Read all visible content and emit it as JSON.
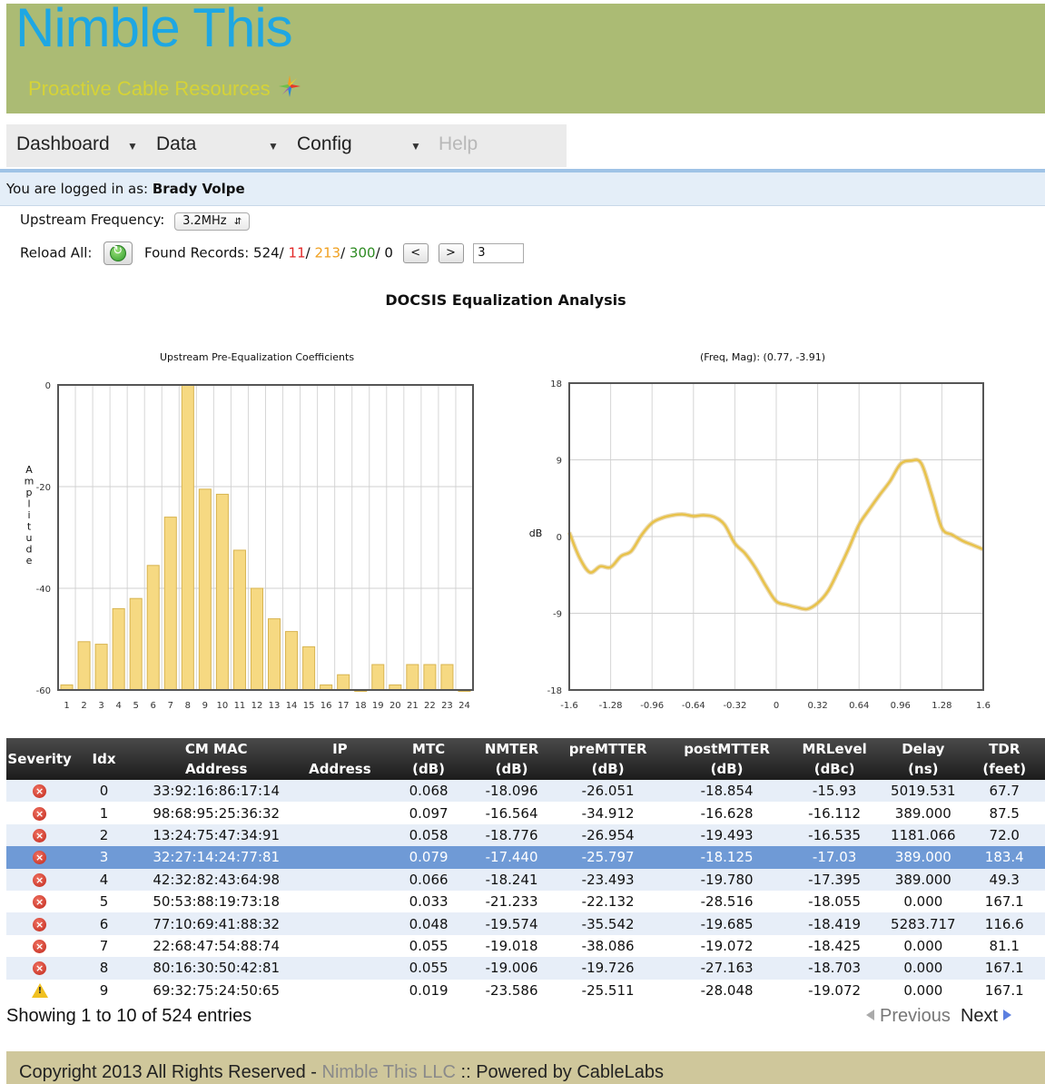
{
  "header": {
    "logo": "Nimble This",
    "tagline": "Proactive Cable Resources"
  },
  "menu": [
    {
      "label": "Dashboard",
      "enabled": true
    },
    {
      "label": "Data",
      "enabled": true
    },
    {
      "label": "Config",
      "enabled": true
    },
    {
      "label": "Help",
      "enabled": false
    }
  ],
  "login": {
    "prefix": "You are logged in as: ",
    "user": "Brady Volpe"
  },
  "controls": {
    "freq_label": "Upstream Frequency:",
    "freq_value": "3.2MHz",
    "reload_label": "Reload All:",
    "found_label": "Found Records: 524/",
    "found_red": "11",
    "found_orange": "213",
    "found_green": "300",
    "found_tail": "0",
    "prev_btn": "<",
    "next_btn": ">",
    "page_value": "3"
  },
  "main_title": "DOCSIS Equalization Analysis",
  "chart_data": [
    {
      "type": "bar",
      "title": "Upstream Pre-Equalization Coefficients",
      "ylabel": "Amplitude",
      "xlabel": "",
      "categories": [
        "1",
        "2",
        "3",
        "4",
        "5",
        "6",
        "7",
        "8",
        "9",
        "10",
        "11",
        "12",
        "13",
        "14",
        "15",
        "16",
        "17",
        "18",
        "19",
        "20",
        "21",
        "22",
        "23",
        "24"
      ],
      "values": [
        -59,
        -50.5,
        -51,
        -44,
        -42,
        -35.5,
        -26,
        0,
        -20.5,
        -21.5,
        -32.5,
        -40,
        -46,
        -48.5,
        -51.5,
        -59,
        -57,
        -60,
        -55,
        -59,
        -55,
        -55,
        -55,
        -60
      ],
      "ylim": [
        -60,
        0
      ],
      "yticks": [
        0,
        -20,
        -40,
        -60
      ],
      "color": "#f6d982",
      "grid": true
    },
    {
      "type": "line",
      "title": "(Freq, Mag): (0.77, -3.91)",
      "ylabel": "dB",
      "xlabel": "",
      "x": [
        -1.6,
        -1.52,
        -1.44,
        -1.36,
        -1.28,
        -1.2,
        -1.12,
        -1.04,
        -0.96,
        -0.88,
        -0.8,
        -0.72,
        -0.64,
        -0.56,
        -0.48,
        -0.4,
        -0.32,
        -0.24,
        -0.16,
        -0.08,
        0,
        0.08,
        0.16,
        0.24,
        0.32,
        0.4,
        0.48,
        0.56,
        0.64,
        0.72,
        0.8,
        0.88,
        0.96,
        1.04,
        1.12,
        1.2,
        1.28,
        1.36,
        1.44,
        1.52,
        1.6
      ],
      "y": [
        0.5,
        -2.5,
        -4.2,
        -3.5,
        -3.6,
        -2.3,
        -1.7,
        0.2,
        1.6,
        2.2,
        2.5,
        2.6,
        2.4,
        2.5,
        2.3,
        1.4,
        -0.8,
        -2.0,
        -3.7,
        -5.8,
        -7.6,
        -8.0,
        -8.3,
        -8.5,
        -7.8,
        -6.4,
        -4.0,
        -1.4,
        1.4,
        3.2,
        4.9,
        6.5,
        8.5,
        8.9,
        8.6,
        5.0,
        1.0,
        0.2,
        -0.5,
        -1.0,
        -1.5
      ],
      "ylim": [
        -18,
        18
      ],
      "xlim": [
        -1.6,
        1.6
      ],
      "yticks": [
        18,
        9,
        0,
        -9,
        -18
      ],
      "xticks": [
        "-1.6",
        "-1.28",
        "-0.96",
        "-0.64",
        "-0.32",
        "0",
        "0.32",
        "0.64",
        "0.96",
        "1.28",
        "1.6"
      ],
      "color": "#e8c24a",
      "grid": true
    }
  ],
  "table": {
    "headers": [
      [
        "Severity"
      ],
      [
        "Idx"
      ],
      [
        "CM MAC",
        "Address"
      ],
      [
        "IP",
        "Address"
      ],
      [
        "MTC",
        "(dB)"
      ],
      [
        "NMTER",
        "(dB)"
      ],
      [
        "preMTTER",
        "(dB)"
      ],
      [
        "postMTTER",
        "(dB)"
      ],
      [
        "MRLevel",
        "(dBc)"
      ],
      [
        "Delay",
        "(ns)"
      ],
      [
        "TDR",
        "(feet)"
      ]
    ],
    "rows": [
      {
        "severity": "error",
        "idx": "0",
        "mac": "33:92:16:86:17:14",
        "ip": "",
        "mtc": "0.068",
        "nmter": "-18.096",
        "pre": "-26.051",
        "post": "-18.854",
        "mrl": "-15.93",
        "delay": "5019.531",
        "tdr": "67.7"
      },
      {
        "severity": "error",
        "idx": "1",
        "mac": "98:68:95:25:36:32",
        "ip": "",
        "mtc": "0.097",
        "nmter": "-16.564",
        "pre": "-34.912",
        "post": "-16.628",
        "mrl": "-16.112",
        "delay": "389.000",
        "tdr": "87.5"
      },
      {
        "severity": "error",
        "idx": "2",
        "mac": "13:24:75:47:34:91",
        "ip": "",
        "mtc": "0.058",
        "nmter": "-18.776",
        "pre": "-26.954",
        "post": "-19.493",
        "mrl": "-16.535",
        "delay": "1181.066",
        "tdr": "72.0"
      },
      {
        "severity": "error",
        "idx": "3",
        "mac": "32:27:14:24:77:81",
        "ip": "",
        "mtc": "0.079",
        "nmter": "-17.440",
        "pre": "-25.797",
        "post": "-18.125",
        "mrl": "-17.03",
        "delay": "389.000",
        "tdr": "183.4",
        "selected": true
      },
      {
        "severity": "error",
        "idx": "4",
        "mac": "42:32:82:43:64:98",
        "ip": "",
        "mtc": "0.066",
        "nmter": "-18.241",
        "pre": "-23.493",
        "post": "-19.780",
        "mrl": "-17.395",
        "delay": "389.000",
        "tdr": "49.3"
      },
      {
        "severity": "error",
        "idx": "5",
        "mac": "50:53:88:19:73:18",
        "ip": "",
        "mtc": "0.033",
        "nmter": "-21.233",
        "pre": "-22.132",
        "post": "-28.516",
        "mrl": "-18.055",
        "delay": "0.000",
        "tdr": "167.1"
      },
      {
        "severity": "error",
        "idx": "6",
        "mac": "77:10:69:41:88:32",
        "ip": "",
        "mtc": "0.048",
        "nmter": "-19.574",
        "pre": "-35.542",
        "post": "-19.685",
        "mrl": "-18.419",
        "delay": "5283.717",
        "tdr": "116.6"
      },
      {
        "severity": "error",
        "idx": "7",
        "mac": "22:68:47:54:88:74",
        "ip": "",
        "mtc": "0.055",
        "nmter": "-19.018",
        "pre": "-38.086",
        "post": "-19.072",
        "mrl": "-18.425",
        "delay": "0.000",
        "tdr": "81.1"
      },
      {
        "severity": "error",
        "idx": "8",
        "mac": "80:16:30:50:42:81",
        "ip": "",
        "mtc": "0.055",
        "nmter": "-19.006",
        "pre": "-19.726",
        "post": "-27.163",
        "mrl": "-18.703",
        "delay": "0.000",
        "tdr": "167.1"
      },
      {
        "severity": "warning",
        "idx": "9",
        "mac": "69:32:75:24:50:65",
        "ip": "",
        "mtc": "0.019",
        "nmter": "-23.586",
        "pre": "-25.511",
        "post": "-28.048",
        "mrl": "-19.072",
        "delay": "0.000",
        "tdr": "167.1"
      }
    ]
  },
  "pagination": {
    "info": "Showing 1 to 10 of 524 entries",
    "previous": "Previous",
    "next": "Next"
  },
  "footer": {
    "prefix": "Copyright 2013 All Rights Reserved - ",
    "company": "Nimble This LLC",
    "suffix": " :: Powered by CableLabs"
  },
  "colors": {
    "header_bg": "#abbb74",
    "logo": "#1ea7e3",
    "tagline": "#d6d336",
    "selected_row": "#6f9ad6",
    "footer_bg": "#cfc79b"
  }
}
